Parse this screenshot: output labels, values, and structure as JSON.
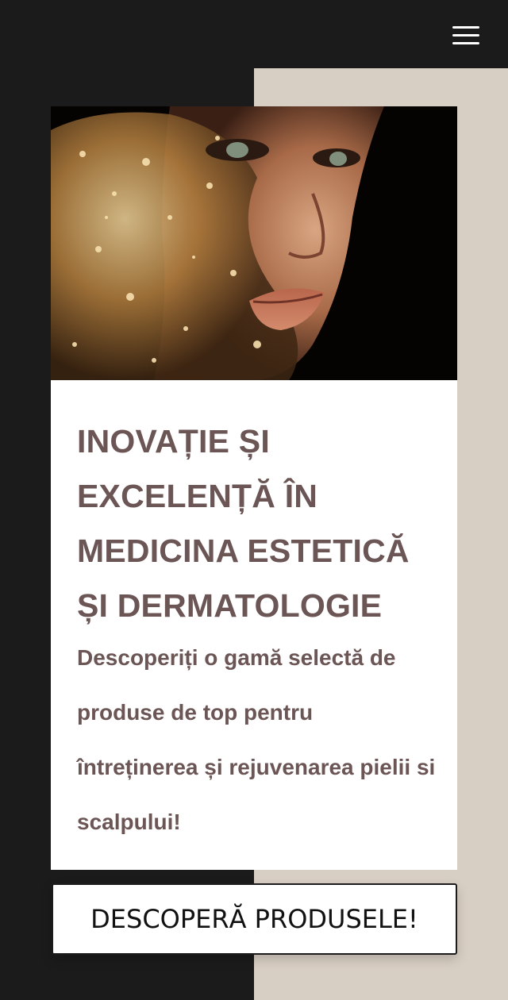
{
  "header": {
    "menu_icon": "hamburger-menu-icon"
  },
  "hero": {
    "image_icon": "woman-face-gold-splash-image",
    "headline": "Inovație și excelență în medicina estetică și dermatologie",
    "subtext": "Descoperiți o gamă selectă de produse de top pentru întreținerea și rejuvenarea pielii si scalpului!",
    "cta_label": "DESCOPERĂ PRODUSELE!"
  },
  "colors": {
    "dark_bg": "#1b1b1b",
    "beige_bg": "#d8cfc4",
    "text_brown": "#6b5555"
  }
}
